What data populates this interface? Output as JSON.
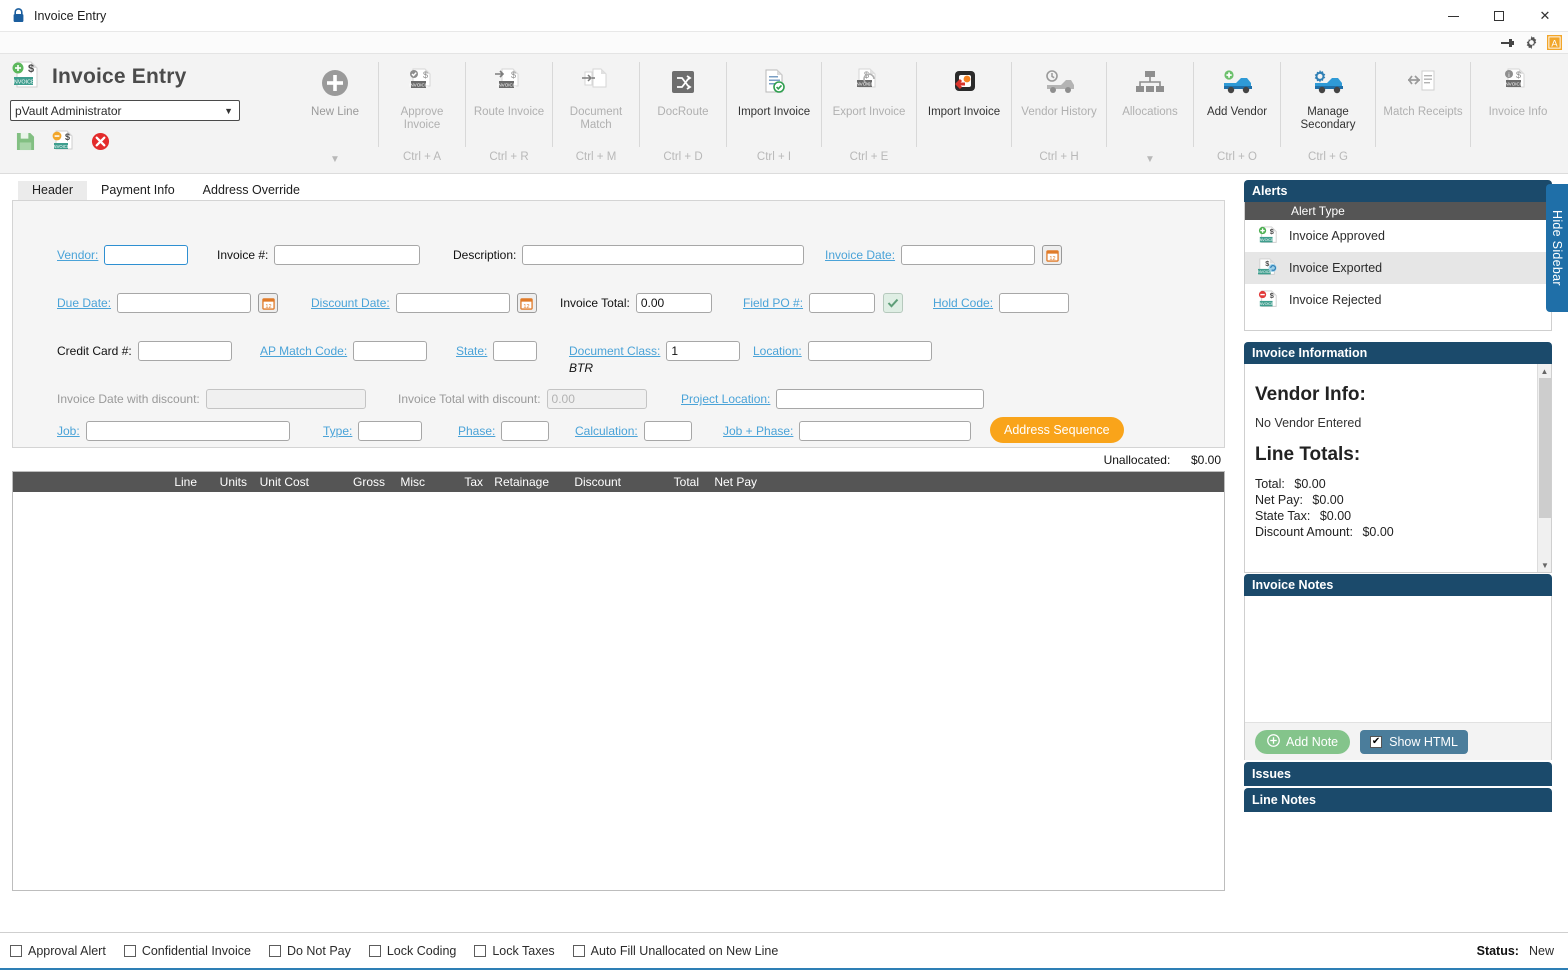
{
  "window": {
    "title": "Invoice Entry",
    "lock_icon": "lock-icon",
    "minimize": "minimize-icon",
    "maximize": "maximize-icon",
    "close": "close-icon"
  },
  "utility_strip": {
    "pin": "pin-icon",
    "settings": "gear-icon",
    "app": "app-badge-icon"
  },
  "ribbon": {
    "app_title": "Invoice Entry",
    "user": "pVault Administrator",
    "actions": [
      {
        "name": "save-icon",
        "label": "Save"
      },
      {
        "name": "new-invoice-icon",
        "label": "New Invoice"
      },
      {
        "name": "cancel-icon",
        "label": "Cancel"
      }
    ],
    "items": [
      {
        "label": "New Line",
        "shortcut": "",
        "enabled": true,
        "dropdown": true,
        "icon": "plus-circle-icon"
      },
      {
        "label": "Approve\nInvoice",
        "shortcut": "Ctrl + A",
        "enabled": false,
        "dropdown": false,
        "icon": "approve-invoice-icon"
      },
      {
        "label": "Route Invoice",
        "shortcut": "Ctrl + R",
        "enabled": false,
        "dropdown": false,
        "icon": "route-invoice-icon"
      },
      {
        "label": "Document\nMatch",
        "shortcut": "Ctrl + M",
        "enabled": false,
        "dropdown": false,
        "icon": "document-match-icon"
      },
      {
        "label": "DocRoute",
        "shortcut": "Ctrl + D",
        "enabled": false,
        "dropdown": false,
        "icon": "docroute-icon"
      },
      {
        "label": "Import Invoice",
        "shortcut": "Ctrl + I",
        "enabled": true,
        "dropdown": false,
        "icon": "import-invoice-icon"
      },
      {
        "label": "Export Invoice",
        "shortcut": "Ctrl + E",
        "enabled": false,
        "dropdown": false,
        "icon": "export-invoice-icon"
      },
      {
        "label": "Import Invoice",
        "shortcut": "",
        "enabled": true,
        "dropdown": false,
        "icon": "import-invoice-alt-icon"
      },
      {
        "label": "Vendor History",
        "shortcut": "Ctrl + H",
        "enabled": false,
        "dropdown": false,
        "icon": "vendor-history-icon"
      },
      {
        "label": "Allocations",
        "shortcut": "",
        "enabled": false,
        "dropdown": true,
        "icon": "allocations-icon"
      },
      {
        "label": "Add Vendor",
        "shortcut": "Ctrl + O",
        "enabled": true,
        "dropdown": false,
        "icon": "add-vendor-icon"
      },
      {
        "label": "Manage\nSecondary",
        "shortcut": "Ctrl + G",
        "enabled": true,
        "dropdown": false,
        "icon": "manage-secondary-icon"
      },
      {
        "label": "Match Receipts",
        "shortcut": "",
        "enabled": false,
        "dropdown": false,
        "icon": "match-receipts-icon"
      },
      {
        "label": "Invoice Info",
        "shortcut": "",
        "enabled": false,
        "dropdown": false,
        "icon": "invoice-info-icon"
      }
    ]
  },
  "tabs": [
    {
      "label": "Header",
      "active": true
    },
    {
      "label": "Payment Info",
      "active": false
    },
    {
      "label": "Address Override",
      "active": false
    }
  ],
  "form": {
    "vendor": {
      "label": "Vendor:",
      "value": "",
      "link": true
    },
    "invoice_number": {
      "label": "Invoice #:",
      "value": "",
      "link": false
    },
    "description": {
      "label": "Description:",
      "value": "",
      "link": false
    },
    "invoice_date": {
      "label": "Invoice Date:",
      "value": "",
      "link": true,
      "calendar": "calendar-icon"
    },
    "due_date": {
      "label": "Due Date:",
      "value": "",
      "link": true,
      "calendar": "calendar-icon"
    },
    "discount_date": {
      "label": "Discount Date:",
      "value": "",
      "link": true,
      "calendar": "calendar-icon"
    },
    "invoice_total": {
      "label": "Invoice Total:",
      "value": "0.00",
      "link": false
    },
    "field_po": {
      "label": "Field PO #:",
      "value": "",
      "link": true,
      "check": "check-icon"
    },
    "hold_code": {
      "label": "Hold Code:",
      "value": "",
      "link": true
    },
    "credit_card": {
      "label": "Credit Card #:",
      "value": "",
      "link": false
    },
    "ap_match_code": {
      "label": "AP Match Code:",
      "value": "",
      "link": true
    },
    "state": {
      "label": "State:",
      "value": "",
      "link": true
    },
    "document_class": {
      "label": "Document Class:",
      "value": "1",
      "link": true,
      "note": "BTR"
    },
    "location": {
      "label": "Location:",
      "value": "",
      "link": true
    },
    "invoice_date_discount": {
      "label": "Invoice Date with discount:",
      "value": "",
      "readonly": true
    },
    "invoice_total_discount": {
      "label": "Invoice Total with discount:",
      "value": "0.00",
      "readonly": true
    },
    "project_location": {
      "label": "Project Location:",
      "value": "",
      "link": true
    },
    "job": {
      "label": "Job:",
      "value": "",
      "link": true
    },
    "type": {
      "label": "Type:",
      "value": "",
      "link": true
    },
    "phase": {
      "label": "Phase:",
      "value": "",
      "link": true
    },
    "calculation": {
      "label": "Calculation:",
      "value": "",
      "link": true
    },
    "job_phase": {
      "label": "Job + Phase:",
      "value": "",
      "link": true
    },
    "address_sequence_button": "Address Sequence"
  },
  "unallocated": {
    "label": "Unallocated:",
    "value": "$0.00"
  },
  "grid": {
    "columns": [
      "Line",
      "Units",
      "Unit Cost",
      "Gross",
      "Misc",
      "Tax",
      "Retainage",
      "Discount",
      "Total",
      "Net Pay"
    ],
    "rows": []
  },
  "sidebar": {
    "hide_label": "Hide Sidebar",
    "alerts": {
      "title": "Alerts",
      "column_header": "Alert Type",
      "rows": [
        {
          "label": "Invoice Approved",
          "icon": "invoice-approved-icon",
          "selected": false
        },
        {
          "label": "Invoice Exported",
          "icon": "invoice-exported-icon",
          "selected": true
        },
        {
          "label": "Invoice Rejected",
          "icon": "invoice-rejected-icon",
          "selected": false
        }
      ]
    },
    "invoice_information": {
      "title": "Invoice Information",
      "vendor_heading": "Vendor Info:",
      "vendor_value": "No Vendor Entered",
      "line_totals_heading": "Line Totals:",
      "line_totals": [
        {
          "label": "Total:",
          "value": "$0.00"
        },
        {
          "label": "Net Pay:",
          "value": "$0.00"
        },
        {
          "label": "State Tax:",
          "value": "$0.00"
        },
        {
          "label": "Discount Amount:",
          "value": "$0.00"
        }
      ]
    },
    "invoice_notes": {
      "title": "Invoice Notes",
      "body": "",
      "add_note_button": "Add Note",
      "show_html_label": "Show HTML",
      "show_html_checked": true
    },
    "issues": {
      "title": "Issues"
    },
    "line_notes": {
      "title": "Line Notes"
    }
  },
  "statusbar": {
    "checkboxes": [
      {
        "label": "Approval Alert",
        "checked": false
      },
      {
        "label": "Confidential Invoice",
        "checked": false
      },
      {
        "label": "Do Not Pay",
        "checked": false
      },
      {
        "label": "Lock Coding",
        "checked": false
      },
      {
        "label": "Lock Taxes",
        "checked": false
      },
      {
        "label": "Auto Fill Unallocated on New Line",
        "checked": false
      }
    ],
    "status_label": "Status:",
    "status_value": "New"
  },
  "colors": {
    "panel_header": "#1b4a6b",
    "hide_sidebar": "#1f6fa8",
    "accent_orange": "#f9a41a",
    "link_blue": "#4aa3d8",
    "grid_header": "#555555",
    "add_note_green": "#84c48b",
    "show_html_blue": "#4b7d9b"
  }
}
